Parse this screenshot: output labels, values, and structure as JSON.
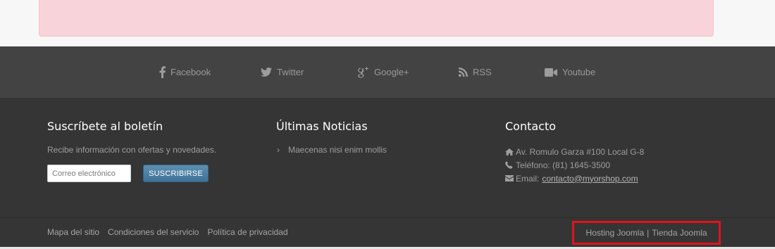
{
  "social": {
    "facebook": "Facebook",
    "twitter": "Twitter",
    "googleplus": "Google+",
    "rss": "RSS",
    "youtube": "Youtube"
  },
  "newsletter": {
    "title": "Suscríbete al boletín",
    "description": "Recibe información con ofertas y novedades.",
    "email_placeholder": "Correo electrónico",
    "button_label": "SUSCRIBIRSE"
  },
  "news": {
    "title": "Últimas Noticias",
    "items": [
      "Maecenas nisi enim mollis"
    ]
  },
  "contact": {
    "title": "Contacto",
    "address": "Av. Romulo Garza #100 Local G-8",
    "phone": "Teléfono: (81) 1645-3500",
    "email_label": "Email:",
    "email": "contacto@myorshop.com"
  },
  "footer_links": [
    "Mapa del sitio",
    "Condiciones del servicio",
    "Política de privacidad"
  ],
  "credits": {
    "hosting": "Hosting Joomla",
    "separator": "|",
    "store": "Tienda Joomla"
  },
  "colors": {
    "alert_bg": "#f9d3da",
    "social_bg": "#434343",
    "footer_bg": "#353535",
    "button_bg": "#4a7ea3",
    "highlight_border": "#e3131b"
  },
  "icons": {
    "facebook": "facebook-icon",
    "twitter": "twitter-icon",
    "googleplus": "google-plus-icon",
    "rss": "rss-icon",
    "youtube": "video-camera-icon",
    "address": "home-icon",
    "phone": "phone-icon",
    "email": "envelope-icon",
    "news_bullet": "chevron-right-icon"
  }
}
